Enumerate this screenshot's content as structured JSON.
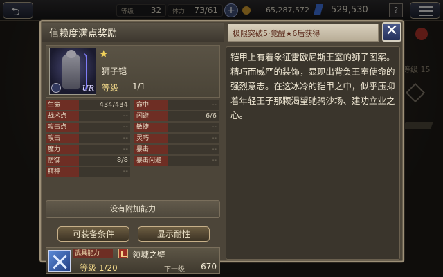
{
  "topbar": {
    "rank_label": "等级",
    "rank_value": "32",
    "stamina_label": "体力",
    "stamina_value": "73/61",
    "gil": "65,287,572",
    "gems": "529,530",
    "help": "?"
  },
  "background": {
    "level_text": "等级 15"
  },
  "dialog": {
    "title": "信赖度满点奖励",
    "condition": "极限突破5·觉醒★6后获得",
    "close": "✕"
  },
  "item": {
    "name": "狮子铠",
    "star": "★",
    "level_label": "等级",
    "level_value": "1/1",
    "rarity": "UR"
  },
  "stats": [
    {
      "label": "生命",
      "value": "434/434"
    },
    {
      "label": "命中",
      "value": "--"
    },
    {
      "label": "战术点",
      "value": "--"
    },
    {
      "label": "闪避",
      "value": "6/6"
    },
    {
      "label": "攻击点",
      "value": "--"
    },
    {
      "label": "敏捷",
      "value": "--"
    },
    {
      "label": "攻击",
      "value": "--"
    },
    {
      "label": "灵巧",
      "value": "--"
    },
    {
      "label": "魔力",
      "value": "--"
    },
    {
      "label": "暴击",
      "value": "--"
    },
    {
      "label": "防御",
      "value": "8/8"
    },
    {
      "label": "暴击闪避",
      "value": "--"
    },
    {
      "label": "精神",
      "value": "--"
    }
  ],
  "no_ability": "没有附加能力",
  "buttons": {
    "conditions": "可装备条件",
    "resistance": "显示耐性"
  },
  "weapon_ability": {
    "label": "武具能力",
    "name": "领域之壁",
    "level": "等级 1/20",
    "next_label": "下一级",
    "next_value": "670"
  },
  "description": "铠甲上有着象征雷欧尼斯王室的狮子图案。精巧而威严的装饰，显现出背负王室使命的强烈意志。在这冰冷的铠甲之中，似乎压抑着年轻王子那颗渴望驰骋沙场、建功立业之心。"
}
